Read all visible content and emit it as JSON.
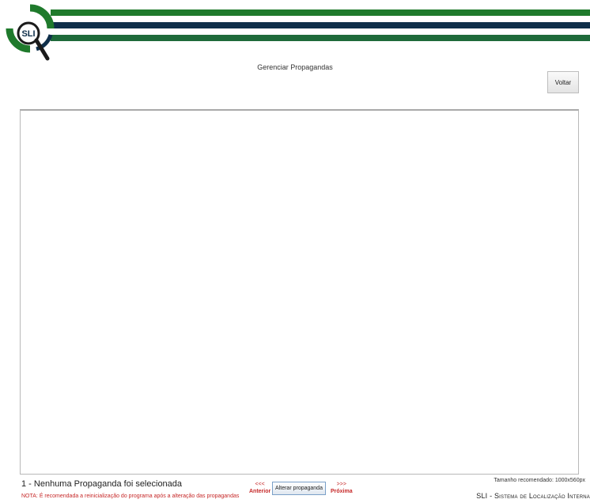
{
  "header": {
    "logo_text": "SLI",
    "title": "Gerenciar Propagandas",
    "back_label": "Voltar",
    "colors": {
      "green": "#1f7a2c",
      "navy": "#0f2f4a",
      "teal_green": "#1e6a3a"
    }
  },
  "preview": {},
  "footer": {
    "status_text": "1 - Nenhuma Propaganda foi selecionada",
    "note_text": "NOTA: É recomendada a reinicialização do programa após a alteração das propagandas",
    "prev_arrows": "<<<",
    "prev_label": "Anterior",
    "change_label": "Alterar propaganda",
    "next_arrows": ">>>",
    "next_label": "Próxima",
    "recommended_size": "Tamanho recomendado: 1000x560px",
    "brand": "SLI - Sistema de Localização Interna"
  }
}
